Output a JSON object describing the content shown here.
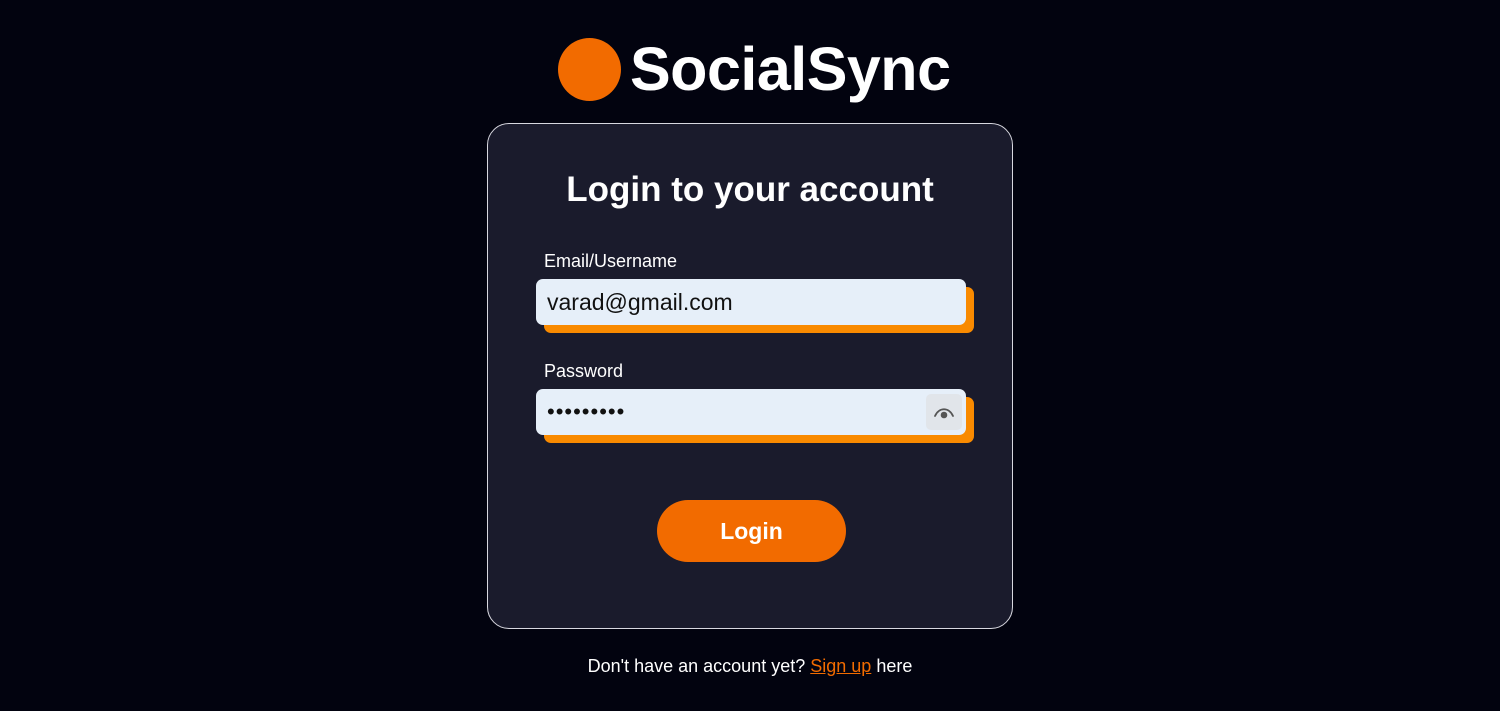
{
  "brand": {
    "name": "SocialSync",
    "accent_color": "#f26b00"
  },
  "login_card": {
    "title": "Login to your account",
    "email": {
      "label": "Email/Username",
      "value": "varad@gmail.com"
    },
    "password": {
      "label": "Password",
      "value": "secret123",
      "toggle_icon": "eye-icon"
    },
    "submit_label": "Login"
  },
  "footer": {
    "prefix": "Don't have an account yet?",
    "link_label": "Sign up",
    "suffix": "here"
  },
  "colors": {
    "background": "#02030f",
    "card": "#1a1b2c",
    "input_shadow": "#f98a00",
    "input_fill": "#e6eff9"
  }
}
